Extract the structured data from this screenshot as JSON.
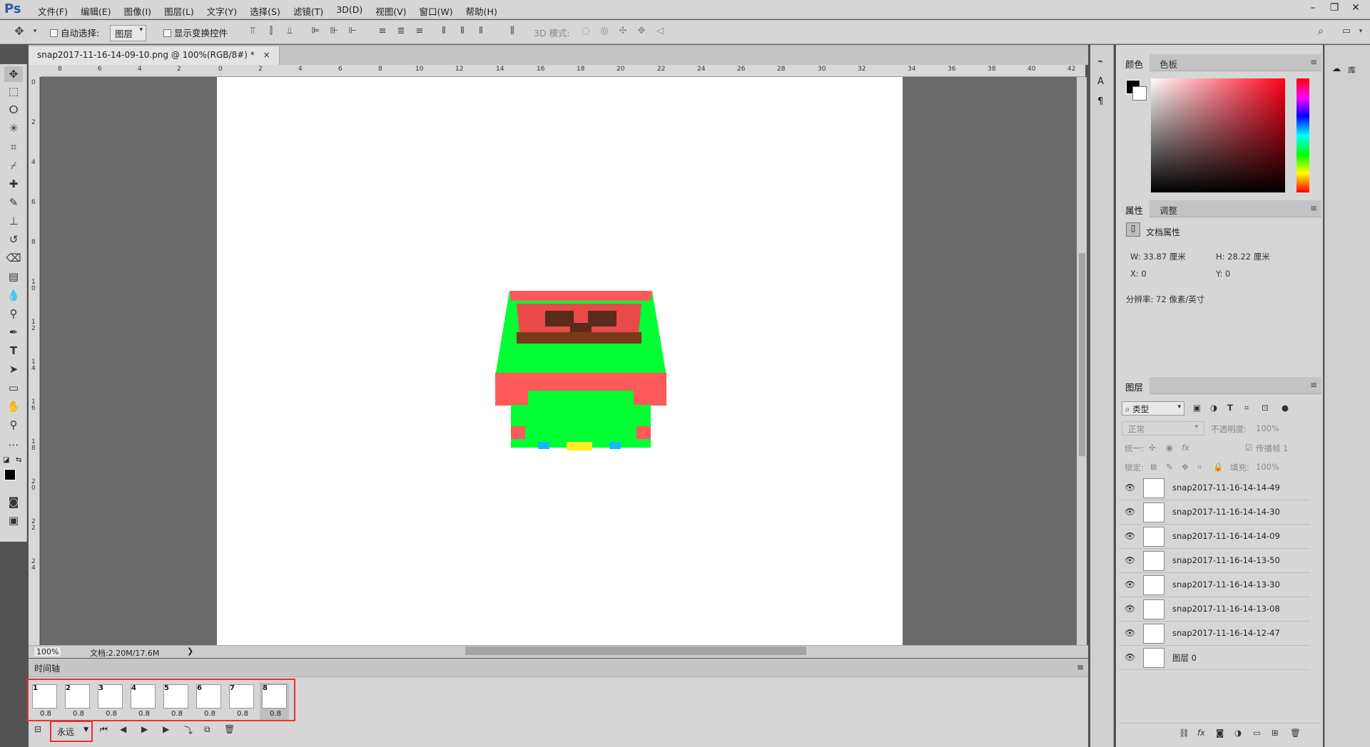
{
  "app": {
    "logo": "Ps"
  },
  "menu": [
    "文件(F)",
    "编辑(E)",
    "图像(I)",
    "图层(L)",
    "文字(Y)",
    "选择(S)",
    "滤镜(T)",
    "3D(D)",
    "视图(V)",
    "窗口(W)",
    "帮助(H)"
  ],
  "window_controls": {
    "minimize": "–",
    "restore": "❐",
    "close": "✕"
  },
  "options": {
    "auto_select_label": "自动选择:",
    "auto_select_value": "图层",
    "show_transform_label": "显示变换控件",
    "mode_3d_label": "3D 模式:"
  },
  "document": {
    "tab_title": "snap2017-11-16-14-09-10.png @ 100%(RGB/8#) *",
    "close": "×",
    "zoom": "100%",
    "doc_size": "文档:2.20M/17.6M",
    "status_arrow": "❯"
  },
  "ruler": {
    "top_labels": [
      "8",
      "6",
      "4",
      "2",
      "0",
      "2",
      "4",
      "6",
      "8",
      "10",
      "12",
      "14",
      "16",
      "18",
      "20",
      "22",
      "24",
      "26",
      "28",
      "30",
      "32",
      "34",
      "36",
      "38",
      "40",
      "42"
    ],
    "left_labels": [
      "0",
      "2",
      "4",
      "6",
      "8",
      "1\n0",
      "1\n2",
      "1\n4",
      "1\n6",
      "1\n8",
      "2\n0",
      "2\n2",
      "2\n4"
    ]
  },
  "timeline": {
    "title": "时间轴",
    "frames": [
      {
        "num": "1",
        "delay": "0.8"
      },
      {
        "num": "2",
        "delay": "0.8"
      },
      {
        "num": "3",
        "delay": "0.8"
      },
      {
        "num": "4",
        "delay": "0.8"
      },
      {
        "num": "5",
        "delay": "0.8"
      },
      {
        "num": "6",
        "delay": "0.8"
      },
      {
        "num": "7",
        "delay": "0.8"
      },
      {
        "num": "8",
        "delay": "0.8"
      }
    ],
    "loop": "永远"
  },
  "color_panel": {
    "tabs": [
      "颜色",
      "色板"
    ]
  },
  "properties_panel": {
    "tabs": [
      "属性",
      "调整"
    ],
    "heading": "文档属性",
    "w": "W:  33.87  厘米",
    "h": "H:  28.22  厘米",
    "x": "X:  0",
    "y": "Y:  0",
    "resolution": "分辨率: 72 像素/英寸"
  },
  "layers_panel": {
    "tab": "图层",
    "filter": "类型",
    "blend_mode": "正常",
    "opacity_label": "不透明度:",
    "opacity_value": "100%",
    "unify_label": "统一:",
    "propagate_label": "传播帧 1",
    "lock_label": "锁定:",
    "fill_label": "填充:",
    "fill_value": "100%",
    "layers": [
      "snap2017-11-16-14-14-49",
      "snap2017-11-16-14-14-30",
      "snap2017-11-16-14-14-09",
      "snap2017-11-16-14-13-50",
      "snap2017-11-16-14-13-30",
      "snap2017-11-16-14-13-08",
      "snap2017-11-16-14-12-47",
      "图层 0"
    ]
  },
  "right_strip": {
    "libraries": "库"
  },
  "colors": {
    "accent_red": "#e53333",
    "lego_green": "#00ff33",
    "lego_red": "#ff5a5a",
    "foreground": "#000000",
    "background": "#ffffff"
  }
}
